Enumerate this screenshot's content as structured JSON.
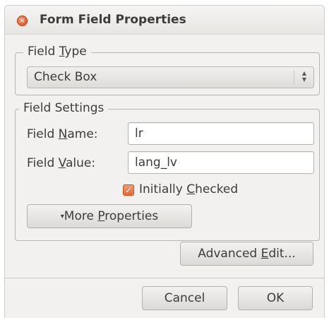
{
  "window": {
    "title": "Form Field Properties",
    "close_glyph": "×"
  },
  "field_type": {
    "legend_pre": "Field ",
    "legend_mnemonic": "T",
    "legend_post": "ype",
    "selected": "Check Box"
  },
  "field_settings": {
    "legend": "Field Settings",
    "name_label_pre": "Field ",
    "name_label_mnemonic": "N",
    "name_label_post": "ame:",
    "name_value": "lr",
    "value_label_pre": "Field ",
    "value_label_mnemonic": "V",
    "value_label_post": "alue:",
    "value_value": "lang_lv",
    "checkbox_label_pre": "Initially ",
    "checkbox_label_mnemonic": "C",
    "checkbox_label_post": "hecked",
    "checkbox_checked": true,
    "more_button_arrow": "▾",
    "more_button_pre": "More ",
    "more_button_mnemonic": "P",
    "more_button_post": "roperties"
  },
  "buttons": {
    "advanced_pre": "Advanced ",
    "advanced_mnemonic": "E",
    "advanced_post": "dit...",
    "cancel": "Cancel",
    "ok": "OK"
  },
  "colors": {
    "accent": "#e4673b",
    "window_bg": "#f2f1f0"
  },
  "icons": {
    "close": "close-icon",
    "combo": "spinner-arrows-icon",
    "check": "checkmark-icon"
  }
}
